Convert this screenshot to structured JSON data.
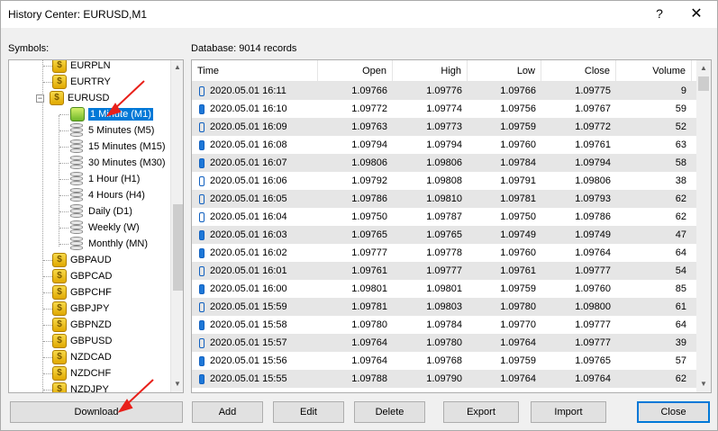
{
  "window": {
    "title": "History Center: EURUSD,M1",
    "help": "?",
    "close": "✕"
  },
  "symbols_label": "Symbols:",
  "database_label": "Database: 9014 records",
  "tree": {
    "above": [
      {
        "label": "EURPLN"
      },
      {
        "label": "EURTRY"
      }
    ],
    "expanded": {
      "label": "EURUSD",
      "expander": "−"
    },
    "timeframes": [
      {
        "label": "1 Minute (M1)",
        "selected": true
      },
      {
        "label": "5 Minutes (M5)"
      },
      {
        "label": "15 Minutes (M15)"
      },
      {
        "label": "30 Minutes (M30)"
      },
      {
        "label": "1 Hour (H1)"
      },
      {
        "label": "4 Hours (H4)"
      },
      {
        "label": "Daily (D1)"
      },
      {
        "label": "Weekly (W)"
      },
      {
        "label": "Monthly (MN)"
      }
    ],
    "below": [
      {
        "label": "GBPAUD"
      },
      {
        "label": "GBPCAD"
      },
      {
        "label": "GBPCHF"
      },
      {
        "label": "GBPJPY"
      },
      {
        "label": "GBPNZD"
      },
      {
        "label": "GBPUSD"
      },
      {
        "label": "NZDCAD"
      },
      {
        "label": "NZDCHF"
      },
      {
        "label": "NZDJPY"
      }
    ],
    "coin_glyph": "$"
  },
  "table": {
    "columns": [
      "Time",
      "Open",
      "High",
      "Low",
      "Close",
      "Volume"
    ],
    "rows": [
      [
        "2020.05.01 16:11",
        "1.09766",
        "1.09776",
        "1.09766",
        "1.09775",
        "9"
      ],
      [
        "2020.05.01 16:10",
        "1.09772",
        "1.09774",
        "1.09756",
        "1.09767",
        "59"
      ],
      [
        "2020.05.01 16:09",
        "1.09763",
        "1.09773",
        "1.09759",
        "1.09772",
        "52"
      ],
      [
        "2020.05.01 16:08",
        "1.09794",
        "1.09794",
        "1.09760",
        "1.09761",
        "63"
      ],
      [
        "2020.05.01 16:07",
        "1.09806",
        "1.09806",
        "1.09784",
        "1.09794",
        "58"
      ],
      [
        "2020.05.01 16:06",
        "1.09792",
        "1.09808",
        "1.09791",
        "1.09806",
        "38"
      ],
      [
        "2020.05.01 16:05",
        "1.09786",
        "1.09810",
        "1.09781",
        "1.09793",
        "62"
      ],
      [
        "2020.05.01 16:04",
        "1.09750",
        "1.09787",
        "1.09750",
        "1.09786",
        "62"
      ],
      [
        "2020.05.01 16:03",
        "1.09765",
        "1.09765",
        "1.09749",
        "1.09749",
        "47"
      ],
      [
        "2020.05.01 16:02",
        "1.09777",
        "1.09778",
        "1.09760",
        "1.09764",
        "64"
      ],
      [
        "2020.05.01 16:01",
        "1.09761",
        "1.09777",
        "1.09761",
        "1.09777",
        "54"
      ],
      [
        "2020.05.01 16:00",
        "1.09801",
        "1.09801",
        "1.09759",
        "1.09760",
        "85"
      ],
      [
        "2020.05.01 15:59",
        "1.09781",
        "1.09803",
        "1.09780",
        "1.09800",
        "61"
      ],
      [
        "2020.05.01 15:58",
        "1.09780",
        "1.09784",
        "1.09770",
        "1.09777",
        "64"
      ],
      [
        "2020.05.01 15:57",
        "1.09764",
        "1.09780",
        "1.09764",
        "1.09777",
        "39"
      ],
      [
        "2020.05.01 15:56",
        "1.09764",
        "1.09768",
        "1.09759",
        "1.09765",
        "57"
      ],
      [
        "2020.05.01 15:55",
        "1.09788",
        "1.09790",
        "1.09764",
        "1.09764",
        "62"
      ]
    ],
    "candle_filled": [
      false,
      true,
      false,
      true,
      true,
      false,
      false,
      false,
      true,
      true,
      false,
      true,
      false,
      true,
      false,
      true,
      true
    ]
  },
  "buttons": {
    "download": "Download",
    "add": "Add",
    "edit": "Edit",
    "delete": "Delete",
    "export": "Export",
    "import": "Import",
    "close": "Close"
  },
  "annotation_color": "#e8201a"
}
